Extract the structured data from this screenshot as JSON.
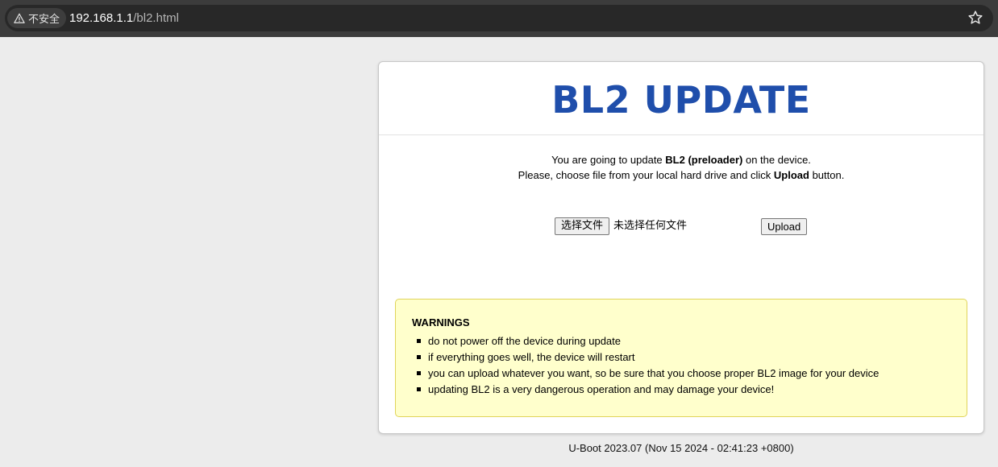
{
  "browser": {
    "security_label": "不安全",
    "url_host": "192.168.1.1",
    "url_path": "/bl2.html",
    "icons": [
      "warning-triangle-icon",
      "bookmark-star-icon"
    ]
  },
  "page": {
    "title": "BL2 UPDATE",
    "title_color": "#1f4eab",
    "intro": {
      "line1_pre": "You are going to update ",
      "line1_bold": "BL2 (preloader)",
      "line1_post": " on the device.",
      "line2_pre": "Please, choose file from your local hard drive and click ",
      "line2_bold": "Upload",
      "line2_post": " button."
    },
    "file_input": {
      "button_label": "选择文件",
      "status_text": "未选择任何文件"
    },
    "upload_label": "Upload",
    "warnings": {
      "title": "WARNINGS",
      "background": "#ffffcc",
      "items": [
        "do not power off the device during update",
        "if everything goes well, the device will restart",
        "you can upload whatever you want, so be sure that you choose proper BL2 image for your device",
        "updating BL2 is a very dangerous operation and may damage your device!"
      ]
    },
    "footer": "U-Boot 2023.07 (Nov 15 2024 - 02:41:23 +0800)"
  }
}
